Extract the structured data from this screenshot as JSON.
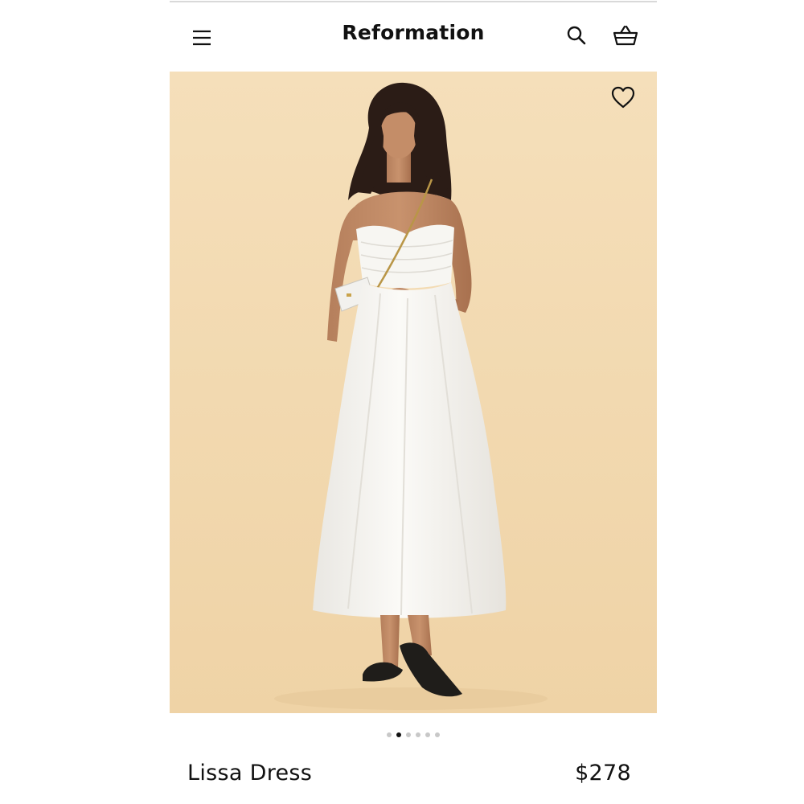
{
  "header": {
    "brand": "Reformation",
    "menu_icon": "menu-icon",
    "search_icon": "search-icon",
    "cart_icon": "shopping-basket-icon"
  },
  "hero": {
    "image_subject": "model in white strapless midi dress",
    "wishlist_icon": "heart-icon",
    "background_color": "#f2d9b0"
  },
  "carousel": {
    "total": 6,
    "active_index": 1
  },
  "product": {
    "name": "Lissa Dress",
    "price": "$278"
  },
  "colors": {
    "text": "#111111",
    "dot_inactive": "#c8c8c8",
    "dot_active": "#111111"
  }
}
